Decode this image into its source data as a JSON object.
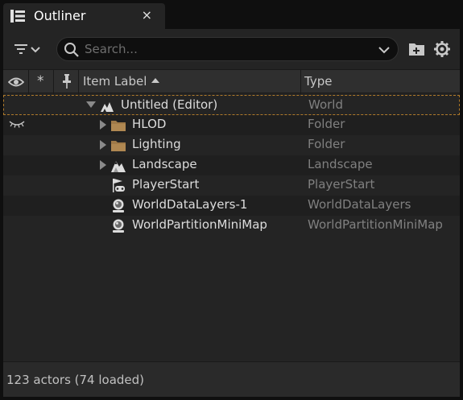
{
  "tab": {
    "title": "Outliner",
    "close": "×",
    "icon": "outliner-icon"
  },
  "toolbar": {
    "filter_icon": "filter-icon",
    "search_placeholder": "Search...",
    "search_value": "",
    "new_folder_icon": "add-folder-icon",
    "settings_icon": "gear-icon"
  },
  "columns": {
    "visibility_icon": "eye-icon",
    "favorite": "*",
    "pin_icon": "pin-icon",
    "label": "Item Label",
    "type": "Type"
  },
  "rows": [
    {
      "label": "Untitled (Editor)",
      "type": "World",
      "icon": "world-icon",
      "expanded": true,
      "depth": 0,
      "selected": true
    },
    {
      "label": "HLOD",
      "type": "Folder",
      "icon": "folder-icon",
      "expanded": false,
      "depth": 1,
      "hidden": true
    },
    {
      "label": "Lighting",
      "type": "Folder",
      "icon": "folder-icon",
      "expanded": false,
      "depth": 1
    },
    {
      "label": "Landscape",
      "type": "Landscape",
      "icon": "landscape-icon",
      "expanded": false,
      "depth": 1
    },
    {
      "label": "PlayerStart",
      "type": "PlayerStart",
      "icon": "player-start-icon",
      "depth": 1
    },
    {
      "label": "WorldDataLayers-1",
      "type": "WorldDataLayers",
      "icon": "actor-sphere-icon",
      "depth": 1
    },
    {
      "label": "WorldPartitionMiniMap",
      "type": "WorldPartitionMiniMap",
      "icon": "actor-sphere-icon",
      "depth": 1
    }
  ],
  "footer": {
    "status": "123 actors (74 loaded)"
  },
  "colors": {
    "folder": "#a07a48",
    "selection_outline": "#b07a2a",
    "background": "#242424"
  }
}
